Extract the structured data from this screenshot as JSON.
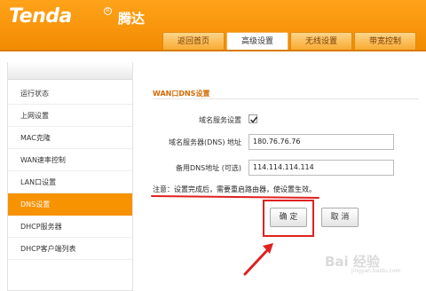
{
  "brand": {
    "logo": "Tenda",
    "logo_cn": "腾达",
    "reg_mark": "R"
  },
  "tabs": [
    {
      "label": "返回首页"
    },
    {
      "label": "高级设置"
    },
    {
      "label": "无线设置"
    },
    {
      "label": "带宽控制"
    }
  ],
  "sidebar": {
    "items": [
      {
        "label": "运行状态"
      },
      {
        "label": "上网设置"
      },
      {
        "label": "MAC克隆"
      },
      {
        "label": "WAN速率控制"
      },
      {
        "label": "LAN口设置"
      },
      {
        "label": "DNS设置"
      },
      {
        "label": "DHCP服务器"
      },
      {
        "label": "DHCP客户端列表"
      }
    ],
    "active_index": 5
  },
  "main": {
    "section_title": "WAN口DNS设置",
    "dns_service_label": "域名服务设置",
    "dns_service_checked": true,
    "primary_dns_label": "域名服务器(DNS) 地址",
    "primary_dns_value": "180.76.76.76",
    "secondary_dns_label": "备用DNS地址 (可选)",
    "secondary_dns_value": "114.114.114.114",
    "note": "注意：设置完成后，需要重启路由器，使设置生效。",
    "ok_button": "确 定",
    "cancel_button": "取 消"
  },
  "watermark": {
    "text": "Bai 经验",
    "sub": "jingyan.baidu.com"
  },
  "colors": {
    "accent": "#f79200",
    "annotation_red": "#e02020",
    "title_orange": "#d46a00"
  }
}
